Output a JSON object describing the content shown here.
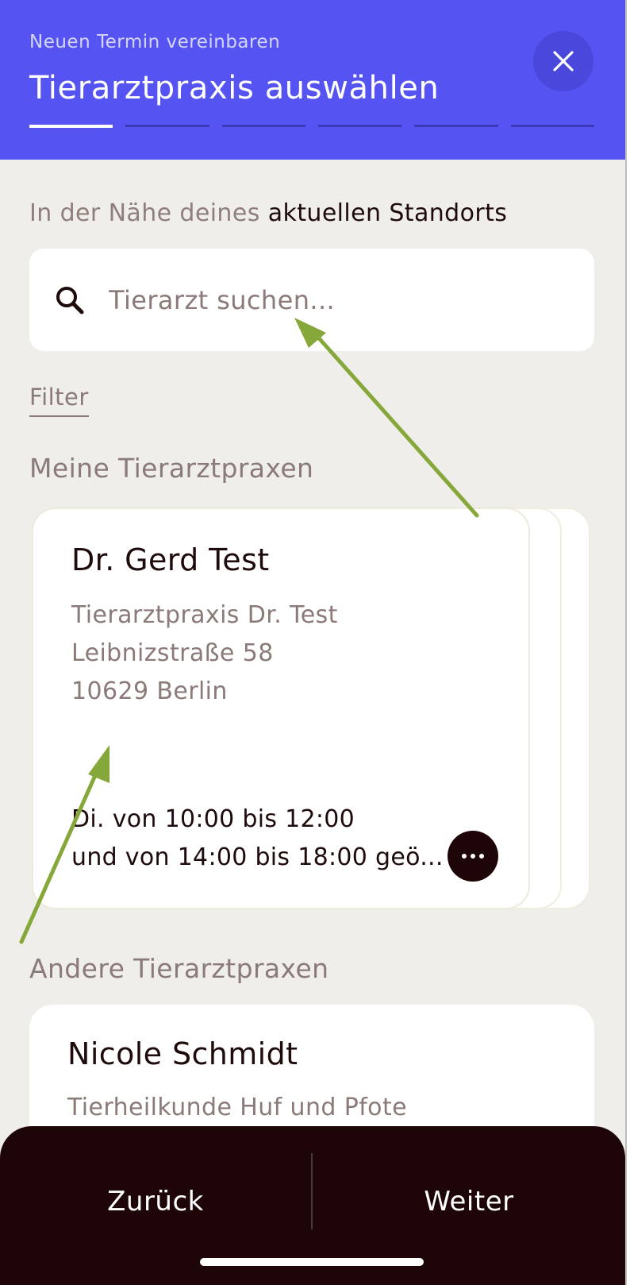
{
  "header": {
    "subtitle": "Neuen Termin vereinbaren",
    "title": "Tierarztpraxis auswählen",
    "close_icon": "close-icon",
    "steps_total": 6,
    "steps_current": 1
  },
  "location": {
    "prefix": "In der Nähe deines",
    "emphasis": "aktuellen Standorts"
  },
  "search": {
    "placeholder": "Tierarzt suchen...",
    "value": "",
    "icon": "search-icon"
  },
  "filter_label": "Filter",
  "my_practices": {
    "heading": "Meine Tierarztpraxen",
    "cards": [
      {
        "name": "Dr. Gerd Test",
        "practice": "Tierarztpraxis Dr. Test",
        "street": "Leibnizstraße 58",
        "city": "10629 Berlin",
        "hours_line1": "Di. von 10:00 bis 12:00",
        "hours_line2": "und von 14:00 bis 18:00 geö...",
        "more_icon": "more-horizontal-icon"
      }
    ]
  },
  "other_practices": {
    "heading": "Andere Tierarztpraxen",
    "cards": [
      {
        "name": "Nicole Schmidt",
        "practice": "Tierheilkunde Huf und Pfote"
      }
    ]
  },
  "footer": {
    "back_label": "Zurück",
    "next_label": "Weiter"
  },
  "colors": {
    "header_bg": "#5553f2",
    "page_bg": "#f0eeea",
    "footer_bg": "#1e0508",
    "annotation_arrow": "#86a83a"
  }
}
